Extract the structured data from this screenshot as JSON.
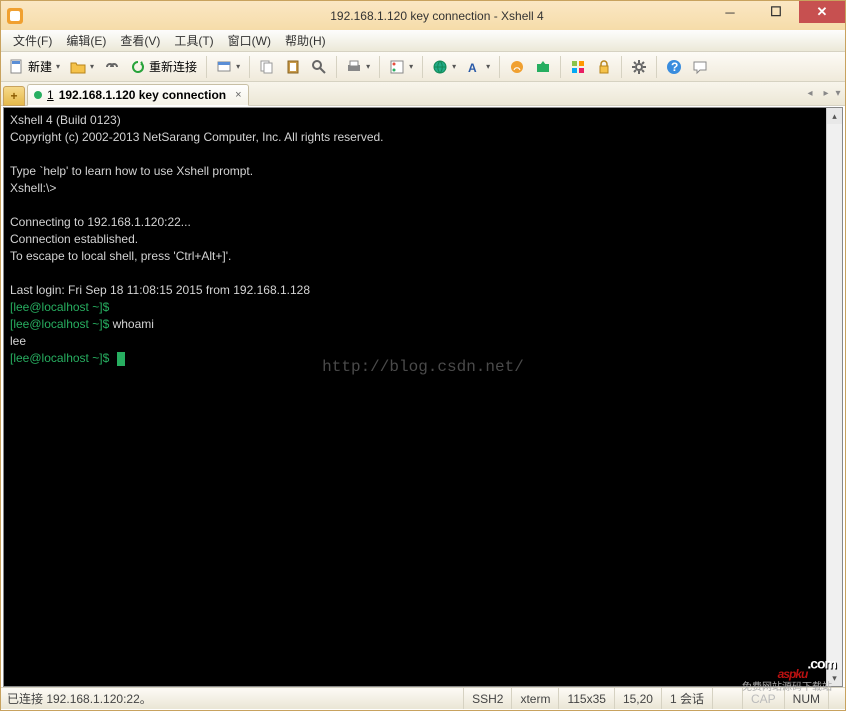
{
  "window": {
    "title": "192.168.1.120 key connection - Xshell 4"
  },
  "menu": {
    "file": "文件(F)",
    "edit": "编辑(E)",
    "view": "查看(V)",
    "tools": "工具(T)",
    "window": "窗口(W)",
    "help": "帮助(H)"
  },
  "toolbar": {
    "new_label": "新建",
    "reconnect_label": "重新连接"
  },
  "tabs": {
    "add": "+",
    "current": {
      "index": "1",
      "label": "192.168.1.120 key connection",
      "close": "×"
    }
  },
  "terminal": {
    "line1": "Xshell 4 (Build 0123)",
    "line2": "Copyright (c) 2002-2013 NetSarang Computer, Inc. All rights reserved.",
    "line3": "",
    "line4": "Type `help' to learn how to use Xshell prompt.",
    "line5": "Xshell:\\>",
    "line6": "",
    "line7": "Connecting to 192.168.1.120:22...",
    "line8": "Connection established.",
    "line9": "To escape to local shell, press 'Ctrl+Alt+]'.",
    "line10": "",
    "line11": "Last login: Fri Sep 18 11:08:15 2015 from 192.168.1.128",
    "prompt1": "[lee@localhost ~]$",
    "prompt2": "[lee@localhost ~]$",
    "cmd1": " whoami",
    "out1": "lee",
    "prompt3": "[lee@localhost ~]$",
    "watermark": "http://blog.csdn.net/"
  },
  "status": {
    "connection": "已连接 192.168.1.120:22。",
    "protocol": "SSH2",
    "termtype": "xterm",
    "size": "115x35",
    "cursor": "15,20",
    "sessions": "1 会话",
    "caps": "CAP",
    "num": "NUM"
  },
  "overlay": {
    "logo_main": "aspku",
    "logo_com": ".com",
    "logo_sub": "免费网站源码下载站"
  }
}
